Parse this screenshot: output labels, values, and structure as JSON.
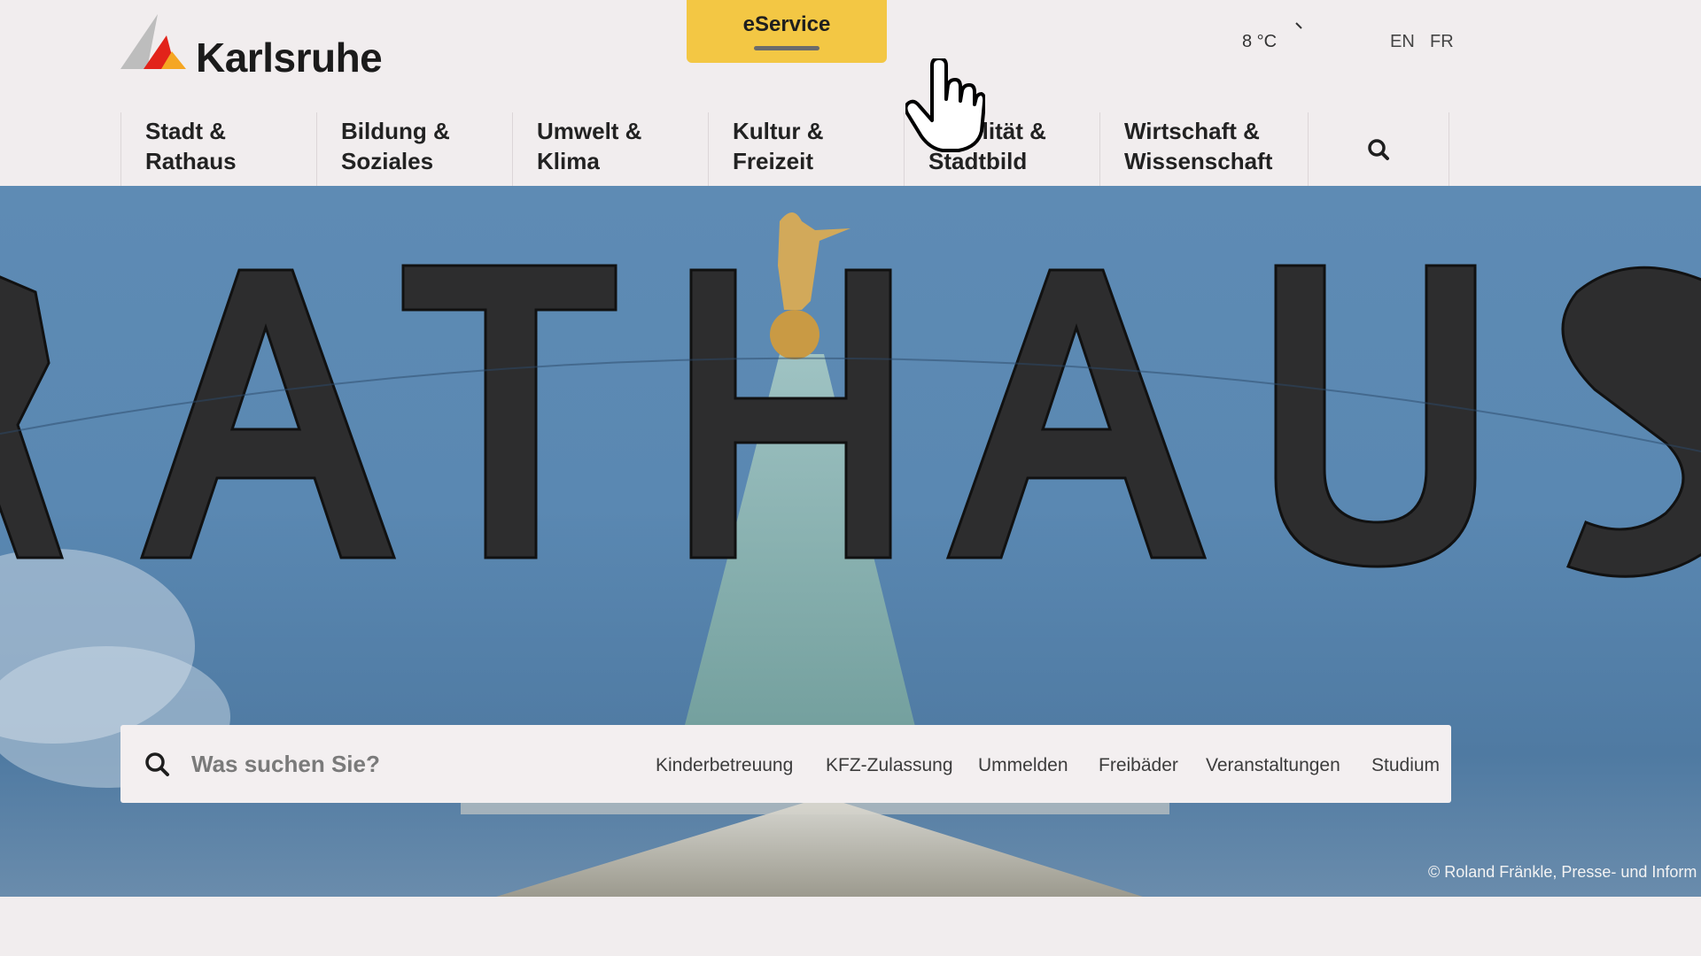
{
  "header": {
    "logo_text": "Karlsruhe",
    "eservice_label": "eService",
    "weather": "8 °C",
    "languages": [
      "EN",
      "FR"
    ]
  },
  "nav": {
    "items": [
      {
        "label": "Stadt &\nRathaus"
      },
      {
        "label": "Bildung &\nSoziales"
      },
      {
        "label": "Umwelt &\nKlima"
      },
      {
        "label": "Kultur &\nFreizeit"
      },
      {
        "label": "Mobilität &\nStadtbild"
      },
      {
        "label": "Wirtschaft &\nWissenschaft"
      }
    ]
  },
  "hero": {
    "sign_text": "RATHAUS",
    "credit": "© Roland Fränkle, Presse- und Inform"
  },
  "search": {
    "placeholder": "Was suchen Sie?",
    "quick_links": [
      "Kinderbetreuung",
      "KFZ-Zulassung",
      "Ummelden",
      "Freibäder",
      "Veranstaltungen",
      "Studium"
    ]
  },
  "colors": {
    "accent_yellow": "#f3c744",
    "logo_red": "#e2231a",
    "logo_orange": "#f5a623",
    "page_bg": "#f1edee",
    "sky_blue": "#5a88b2"
  }
}
